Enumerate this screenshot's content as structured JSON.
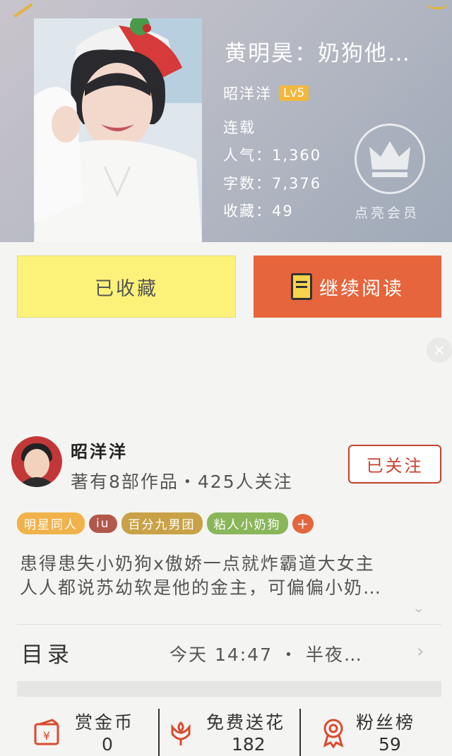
{
  "book": {
    "title": "黄明昊：奶狗他…",
    "author": "昭洋洋",
    "level": "Lv5",
    "status": "连载",
    "popularity": "人气：1,360",
    "word_count": "字数：7,376",
    "favorites": "收藏：49",
    "vip_label": "点亮会员"
  },
  "actions": {
    "favorited_label": "已收藏",
    "continue_label": "继续阅读",
    "close_glyph": "×"
  },
  "author_profile": {
    "name": "昭洋洋",
    "stats": "著有8部作品・425人关注",
    "follow_label": "已关注"
  },
  "tags": [
    {
      "label": "明星同人",
      "color": "#f0b24a"
    },
    {
      "label": "iu",
      "color": "#b0584a"
    },
    {
      "label": "百分九男团",
      "color": "#c9a147"
    },
    {
      "label": "粘人小奶狗",
      "color": "#8ab65a"
    }
  ],
  "tag_add": "+",
  "summary": {
    "line1": "患得患失小奶狗x傲娇一点就炸霸道大女主",
    "line2": "人人都说苏幼软是他的金主，可偏偏小奶…"
  },
  "toc": {
    "label": "目录",
    "latest": "今天 14:47 ・ 半夜…",
    "chevron": "›",
    "expand": "⌄"
  },
  "footer": {
    "reward": {
      "label": "赏金币",
      "value": "0",
      "icon": "gift-card-icon"
    },
    "flower": {
      "label": "免费送花",
      "value": "182",
      "icon": "flower-icon"
    },
    "fans": {
      "label": "粉丝榜",
      "value": "59",
      "icon": "medal-icon"
    }
  },
  "colors": {
    "accent_orange": "#e6653c",
    "favorite_yellow": "#fcf27a",
    "follow_red": "#c8412f",
    "level_gold": "#f0b83f"
  }
}
